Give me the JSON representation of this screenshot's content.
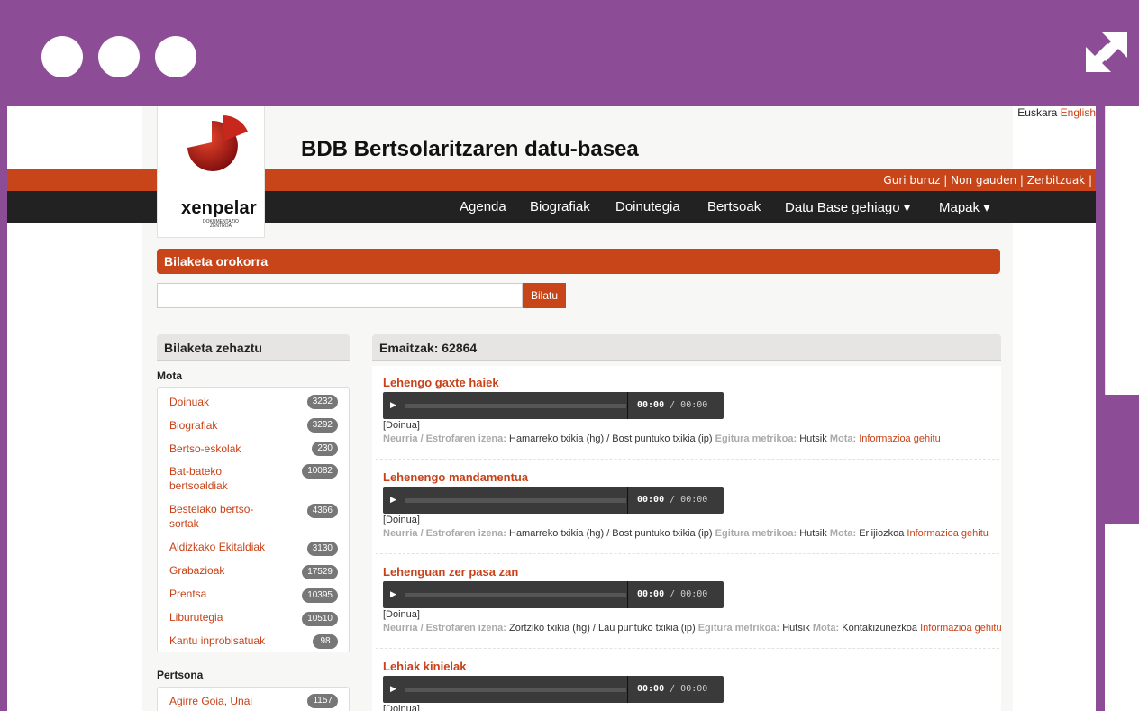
{
  "site": {
    "title": "BDB Bertsolaritzaren datu-basea",
    "logo": {
      "name": "xenpelar",
      "sub1": "DOKUMENTAZIO",
      "sub2": "ZENTROA"
    },
    "languages": {
      "current": "Euskara",
      "other": "English"
    },
    "top_links": "Guri buruz | Non gauden | Zerbitzuak |",
    "nav": [
      "Agenda",
      "Biografiak",
      "Doinutegia",
      "Bertsoak",
      "Datu Base gehiago ▾",
      "Mapak ▾"
    ]
  },
  "search": {
    "heading": "Bilaketa orokorra",
    "value": "",
    "button": "Bilatu"
  },
  "facets": {
    "heading": "Bilaketa zehaztu",
    "mota_label": "Mota",
    "mota": [
      {
        "label": "Doinuak",
        "count": "3232"
      },
      {
        "label": "Biografiak",
        "count": "3292"
      },
      {
        "label": "Bertso-eskolak",
        "count": "230"
      },
      {
        "label": "Bat-bateko bertsoaldiak",
        "count": "10082"
      },
      {
        "label": "Bestelako bertso-sortak",
        "count": "4366"
      },
      {
        "label": "Aldizkako Ekitaldiak",
        "count": "3130"
      },
      {
        "label": "Grabazioak",
        "count": "17529"
      },
      {
        "label": "Prentsa",
        "count": "10395"
      },
      {
        "label": "Liburutegia",
        "count": "10510"
      },
      {
        "label": "Kantu inprobisatuak",
        "count": "98"
      }
    ],
    "pertsona_label": "Pertsona",
    "pertsona": [
      {
        "label": "Agirre Goia, Unai",
        "count": "1157"
      }
    ]
  },
  "results": {
    "heading": "Emaitzak: 62864",
    "player_time": "00:00",
    "player_duration": "/ 00:00",
    "labels": {
      "neurria": "Neurria / Estrofaren izena:",
      "egitura": "Egitura metrikoa:",
      "mota": "Mota:",
      "info": "Informazioa gehitu"
    },
    "items": [
      {
        "title": "Lehengo gaxte haiek",
        "type": "[Doinua]",
        "neurria": "Hamarreko txikia (hg) / Bost puntuko txikia (ip)",
        "egitura": "Hutsik",
        "mota": ""
      },
      {
        "title": "Lehenengo mandamentua",
        "type": "[Doinua]",
        "neurria": "Hamarreko txikia (hg) / Bost puntuko txikia (ip)",
        "egitura": "Hutsik",
        "mota": "Erlijiozkoa"
      },
      {
        "title": "Lehenguan zer pasa zan",
        "type": "[Doinua]",
        "neurria": "Zortziko txikia (hg) / Lau puntuko txikia (ip)",
        "egitura": "Hutsik",
        "mota": "Kontakizunezkoa"
      },
      {
        "title": "Lehiak kinielak",
        "type": "[Doinua]"
      }
    ]
  },
  "colors": {
    "frame": "#8d4d96",
    "accent": "#c8451a",
    "nav": "#222222"
  }
}
